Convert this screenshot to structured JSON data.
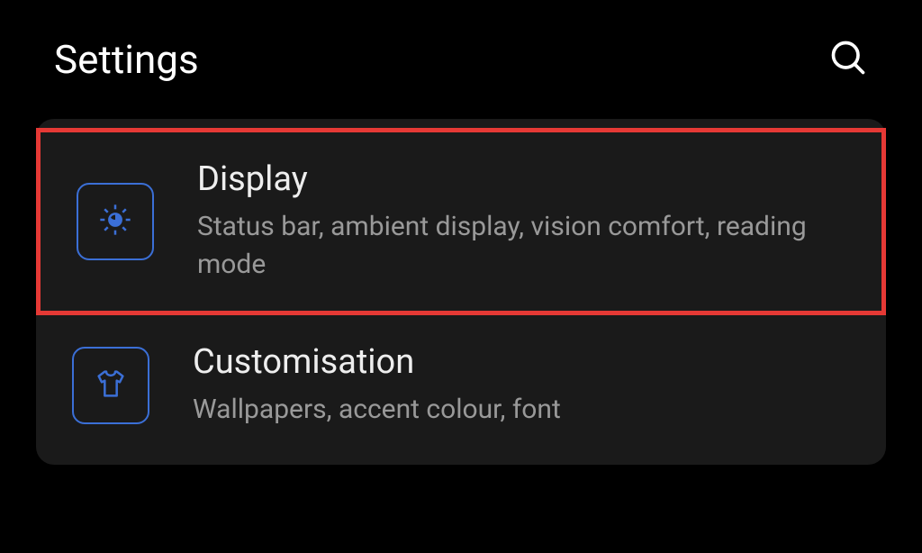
{
  "header": {
    "title": "Settings"
  },
  "items": [
    {
      "title": "Display",
      "description": "Status bar, ambient display, vision comfort, reading mode",
      "highlighted": true
    },
    {
      "title": "Customisation",
      "description": "Wallpapers, accent colour, font",
      "highlighted": false
    }
  ],
  "colors": {
    "accent": "#3b6fd6",
    "highlight": "#e53935"
  }
}
